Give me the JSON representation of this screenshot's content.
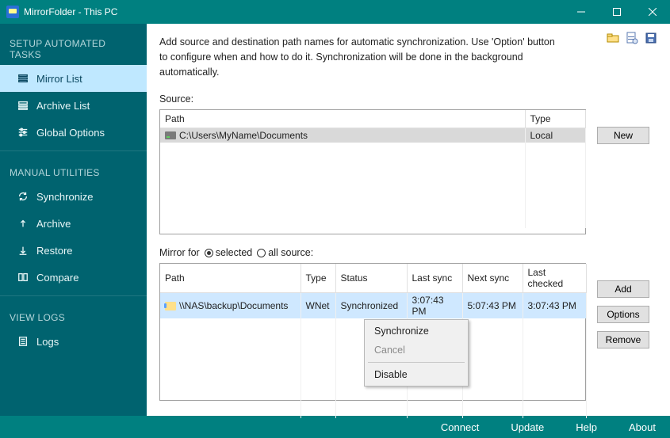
{
  "window": {
    "title": "MirrorFolder - This PC",
    "min_label": "Minimize",
    "max_label": "Maximize",
    "close_label": "Close"
  },
  "sidebar": {
    "groups": [
      {
        "label": "SETUP AUTOMATED TASKS",
        "items": [
          {
            "label": "Mirror List",
            "selected": true
          },
          {
            "label": "Archive List"
          },
          {
            "label": "Global Options"
          }
        ]
      },
      {
        "label": "MANUAL UTILITIES",
        "items": [
          {
            "label": "Synchronize"
          },
          {
            "label": "Archive"
          },
          {
            "label": "Restore"
          },
          {
            "label": "Compare"
          }
        ]
      },
      {
        "label": "VIEW LOGS",
        "items": [
          {
            "label": "Logs"
          }
        ]
      }
    ]
  },
  "main": {
    "description": "Add source and destination path names for automatic synchronization. Use 'Option' button to configure when and how to do it. Synchronization will be done in the background automatically.",
    "source": {
      "label": "Source:",
      "headers": {
        "path": "Path",
        "type": "Type"
      },
      "rows": [
        {
          "path": "C:\\Users\\MyName\\Documents",
          "type": "Local",
          "selected": true
        }
      ],
      "buttons": {
        "new": "New"
      }
    },
    "mirror": {
      "label_prefix": "Mirror for",
      "radio": {
        "selected": "selected",
        "all": "all source:",
        "choice": "selected"
      },
      "headers": {
        "path": "Path",
        "type": "Type",
        "status": "Status",
        "last_sync": "Last sync",
        "next_sync": "Next sync",
        "last_checked": "Last checked"
      },
      "rows": [
        {
          "path": "\\\\NAS\\backup\\Documents",
          "type": "WNet",
          "status": "Synchronized",
          "last_sync": "3:07:43 PM",
          "next_sync": "5:07:43 PM",
          "last_checked": "3:07:43 PM",
          "selected": true
        }
      ],
      "buttons": {
        "add": "Add",
        "options": "Options",
        "remove": "Remove"
      }
    },
    "context_menu": {
      "synchronize": "Synchronize",
      "cancel": "Cancel",
      "disable": "Disable"
    }
  },
  "statusbar": {
    "connect": "Connect",
    "update": "Update",
    "help": "Help",
    "about": "About"
  }
}
